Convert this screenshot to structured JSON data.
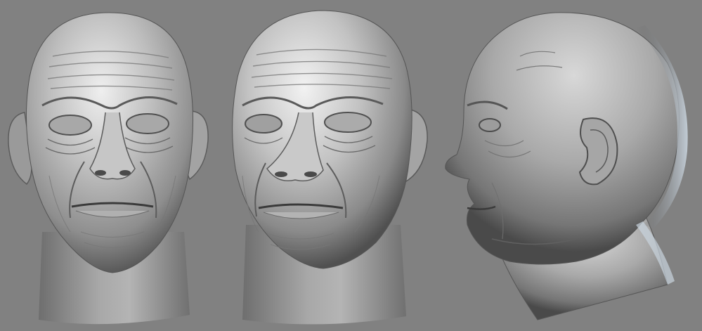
{
  "scene": {
    "background_color": "#818181",
    "clay_highlight": "#f2f2f2",
    "clay_mid": "#b9b9b9",
    "clay_shadow": "#4a4a4a",
    "rim_light": "#bfcbd6",
    "views": [
      {
        "name": "front-view",
        "icon": "sculpted-head-front"
      },
      {
        "name": "three-quarter-view",
        "icon": "sculpted-head-three-quarter"
      },
      {
        "name": "profile-view",
        "icon": "sculpted-head-side"
      }
    ]
  }
}
